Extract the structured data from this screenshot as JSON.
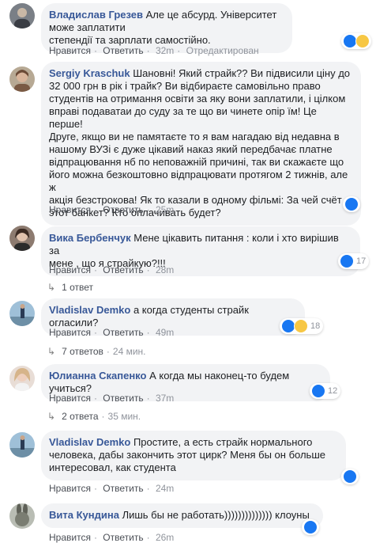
{
  "comments": [
    {
      "author": "Владислав Грезев",
      "lines": [
        "Але це абсурд. Університет може заплатити",
        "степендії та зарплати самостійно."
      ],
      "actions": {
        "like": "Нравится",
        "reply": "Ответить",
        "time": "32m",
        "extra": "Отредактирован"
      },
      "reaction": {
        "icons": [
          "like",
          "sad"
        ],
        "count": ""
      }
    },
    {
      "author": "Sergiy Kraschuk",
      "first": "Шановні! Який страйк?? Ви підвисили ціну до",
      "lines": [
        "32 000 грн в рік і трайк? Ви відбираєте самовільно право",
        "студентів на отримання освіти за яку вони заплатили, і цілком",
        "вправі подаватаи до суду за те що ви чинете опір їм! Це перше!",
        "Друге, якщо ви не памятаєте то я вам нагадаю від недавна в",
        "нашому ВУЗі є дуже цікавий наказ який передбачає платне",
        "відпрацювання нб по неповажній причині, так ви скажаєте що",
        "його можна безкоштовно відпрацювати протягом 2 тижнів, але ж",
        "акція безстрокова! Як то казали в одному фільмі: За чей счёт",
        "этот банкет? Кто оплачивать будет?"
      ],
      "actions": {
        "like": "Нравится",
        "reply": "Ответить",
        "time": "25m"
      },
      "reaction": {
        "icons": [
          "like"
        ],
        "count": ""
      }
    },
    {
      "author": "Вика Бербенчук",
      "first": "Мене цікавить питання : коли і хто вирішив за",
      "lines": [
        "мене , що я страйкую?!!!"
      ],
      "actions": {
        "like": "Нравится",
        "reply": "Ответить",
        "time": "28m"
      },
      "reaction": {
        "icons": [
          "like"
        ],
        "count": "17"
      },
      "replies": {
        "text": "1 ответ",
        "time": ""
      }
    },
    {
      "author": "Vladislav Demko",
      "first": "а когда студенты страйк огласили?",
      "lines": [],
      "actions": {
        "like": "Нравится",
        "reply": "Ответить",
        "time": "49m"
      },
      "reaction": {
        "icons": [
          "like",
          "haha"
        ],
        "count": "18"
      },
      "replies": {
        "text": "7 ответов",
        "time": "24 мин."
      }
    },
    {
      "author": "Юлианна Скапенко",
      "first": "А когда мы наконец-то будем учиться?",
      "lines": [],
      "actions": {
        "like": "Нравится",
        "reply": "Ответить",
        "time": "37m"
      },
      "reaction": {
        "icons": [
          "like"
        ],
        "count": "12"
      },
      "replies": {
        "text": "2 ответа",
        "time": "35 мин."
      }
    },
    {
      "author": "Vladislav Demko",
      "first": "Простите, а есть страйк нормального",
      "lines": [
        "человека, дабы закончить этот цирк? Меня бы он больше",
        "интересовал, как студента"
      ],
      "actions": {
        "like": "Нравится",
        "reply": "Ответить",
        "time": "24m"
      },
      "reaction": {
        "icons": [
          "like"
        ],
        "count": ""
      }
    },
    {
      "author": "Вита Кундина",
      "first": "Лишь бы не работать)))))))))))))) клоуны",
      "lines": [],
      "actions": {
        "like": "Нравится",
        "reply": "Ответить",
        "time": "26m"
      },
      "reaction": {
        "icons": [
          "like"
        ],
        "count": ""
      }
    }
  ],
  "colors": {
    "link": "#385898",
    "bubble": "#f2f3f5",
    "like": "#1877f2",
    "muted": "#90949c"
  }
}
